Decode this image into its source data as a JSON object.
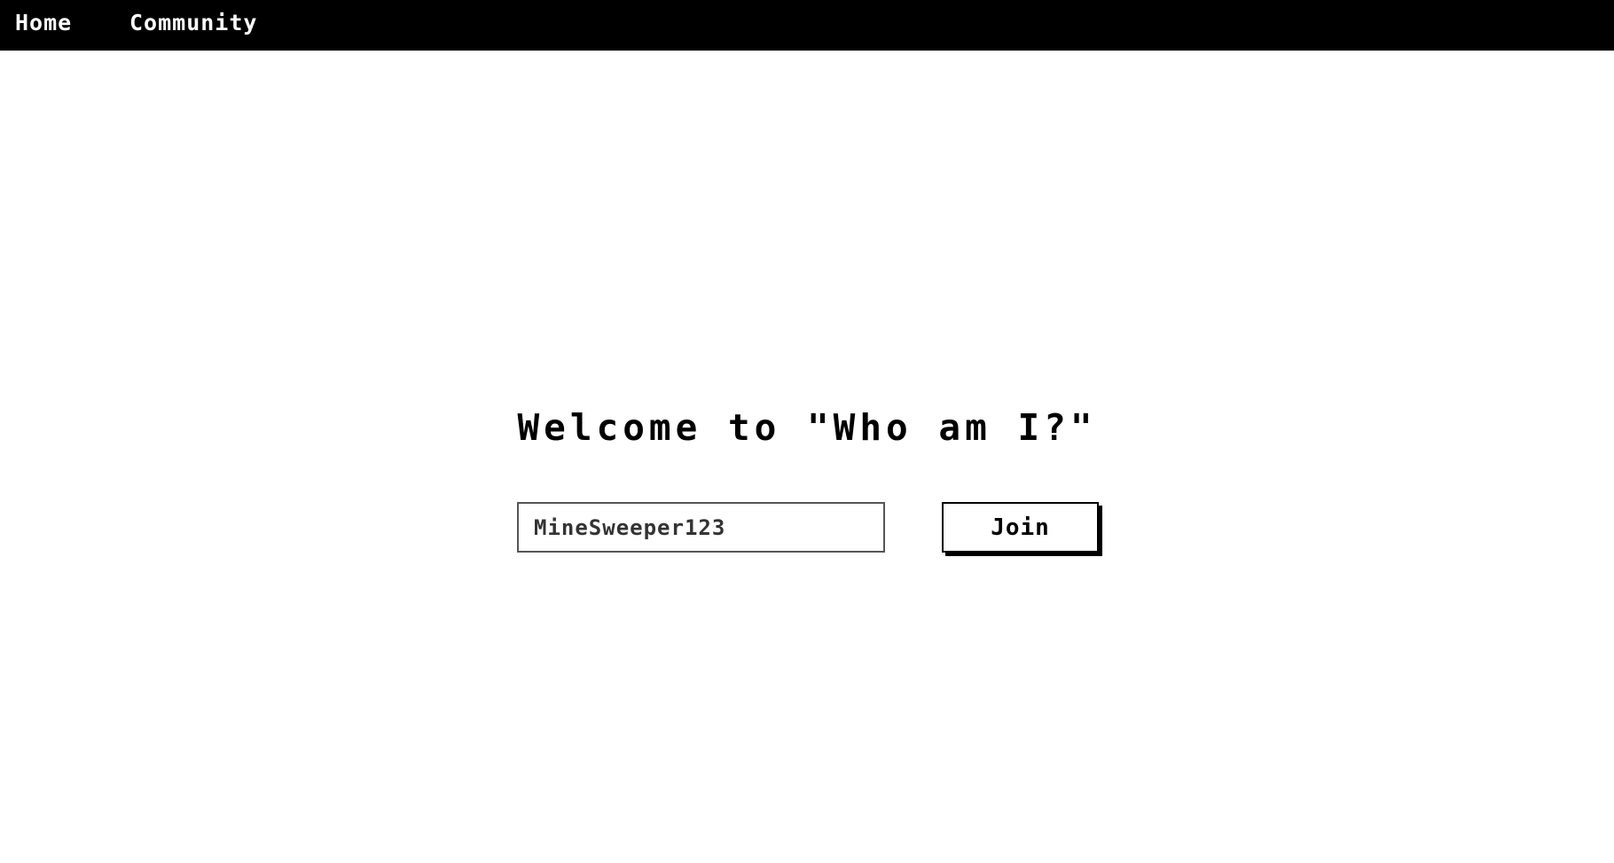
{
  "nav": {
    "home_label": "Home",
    "community_label": "Community"
  },
  "main": {
    "title": "Welcome to \"Who am I?\"",
    "name_input_value": "MineSweeper123",
    "join_label": "Join"
  },
  "colors": {
    "navbar_background": "#000000",
    "nav_text": "#ffffff",
    "page_background": "#ffffff",
    "text": "#000000"
  }
}
